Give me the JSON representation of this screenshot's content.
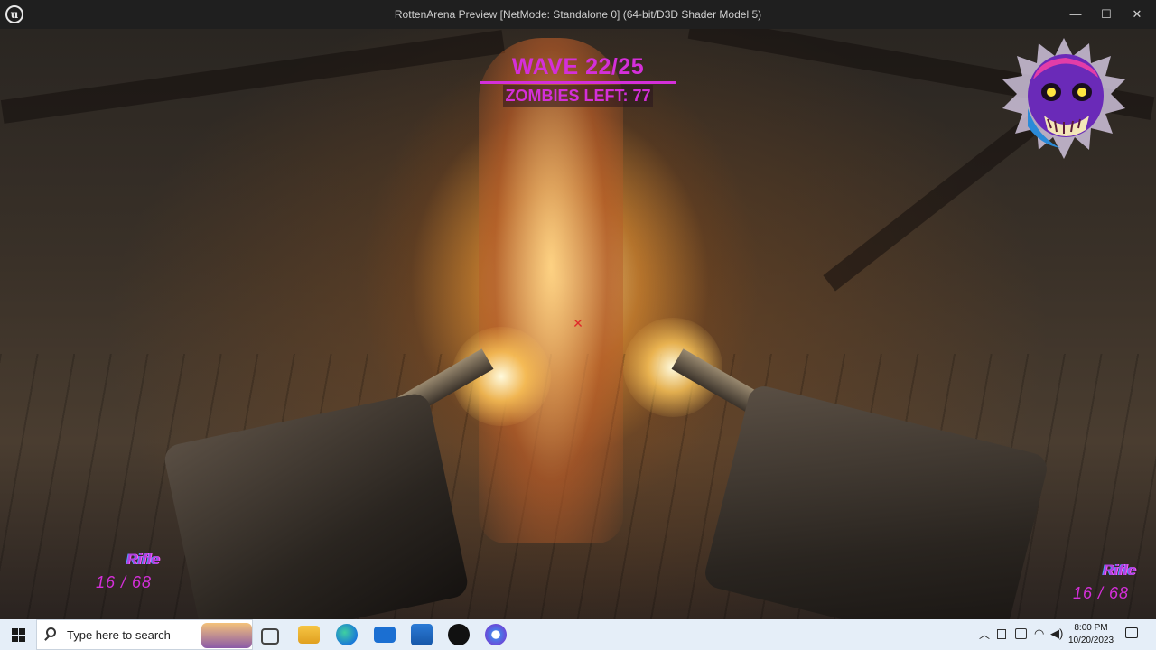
{
  "window": {
    "title": "RottenArena Preview [NetMode: Standalone 0]  (64-bit/D3D Shader Model 5)",
    "app_logo_glyph": "u",
    "controls": {
      "minimize": "—",
      "maximize": "☐",
      "close": "✕"
    }
  },
  "hud": {
    "wave": "WAVE 22/25",
    "zombies_left": "ZOMBIES LEFT: 77",
    "crosshair": "✕",
    "accent_color": "#d42fd9",
    "left_weapon": {
      "name": "Rifle",
      "ammo": "16 / 68"
    },
    "right_weapon": {
      "name": "Rifle",
      "ammo": "16 / 68"
    }
  },
  "taskbar": {
    "search_placeholder": "Type here to search",
    "clock_time": "8:00 PM",
    "clock_date": "10/20/2023",
    "pinned_icons": [
      "task-view-icon",
      "file-explorer-icon",
      "edge-icon",
      "mail-icon",
      "store-icon",
      "unreal-engine-icon",
      "chrome-icon"
    ],
    "tray_icons": [
      "chevron-up-icon",
      "device-icon",
      "meet-icon",
      "network-icon",
      "volume-icon"
    ]
  }
}
